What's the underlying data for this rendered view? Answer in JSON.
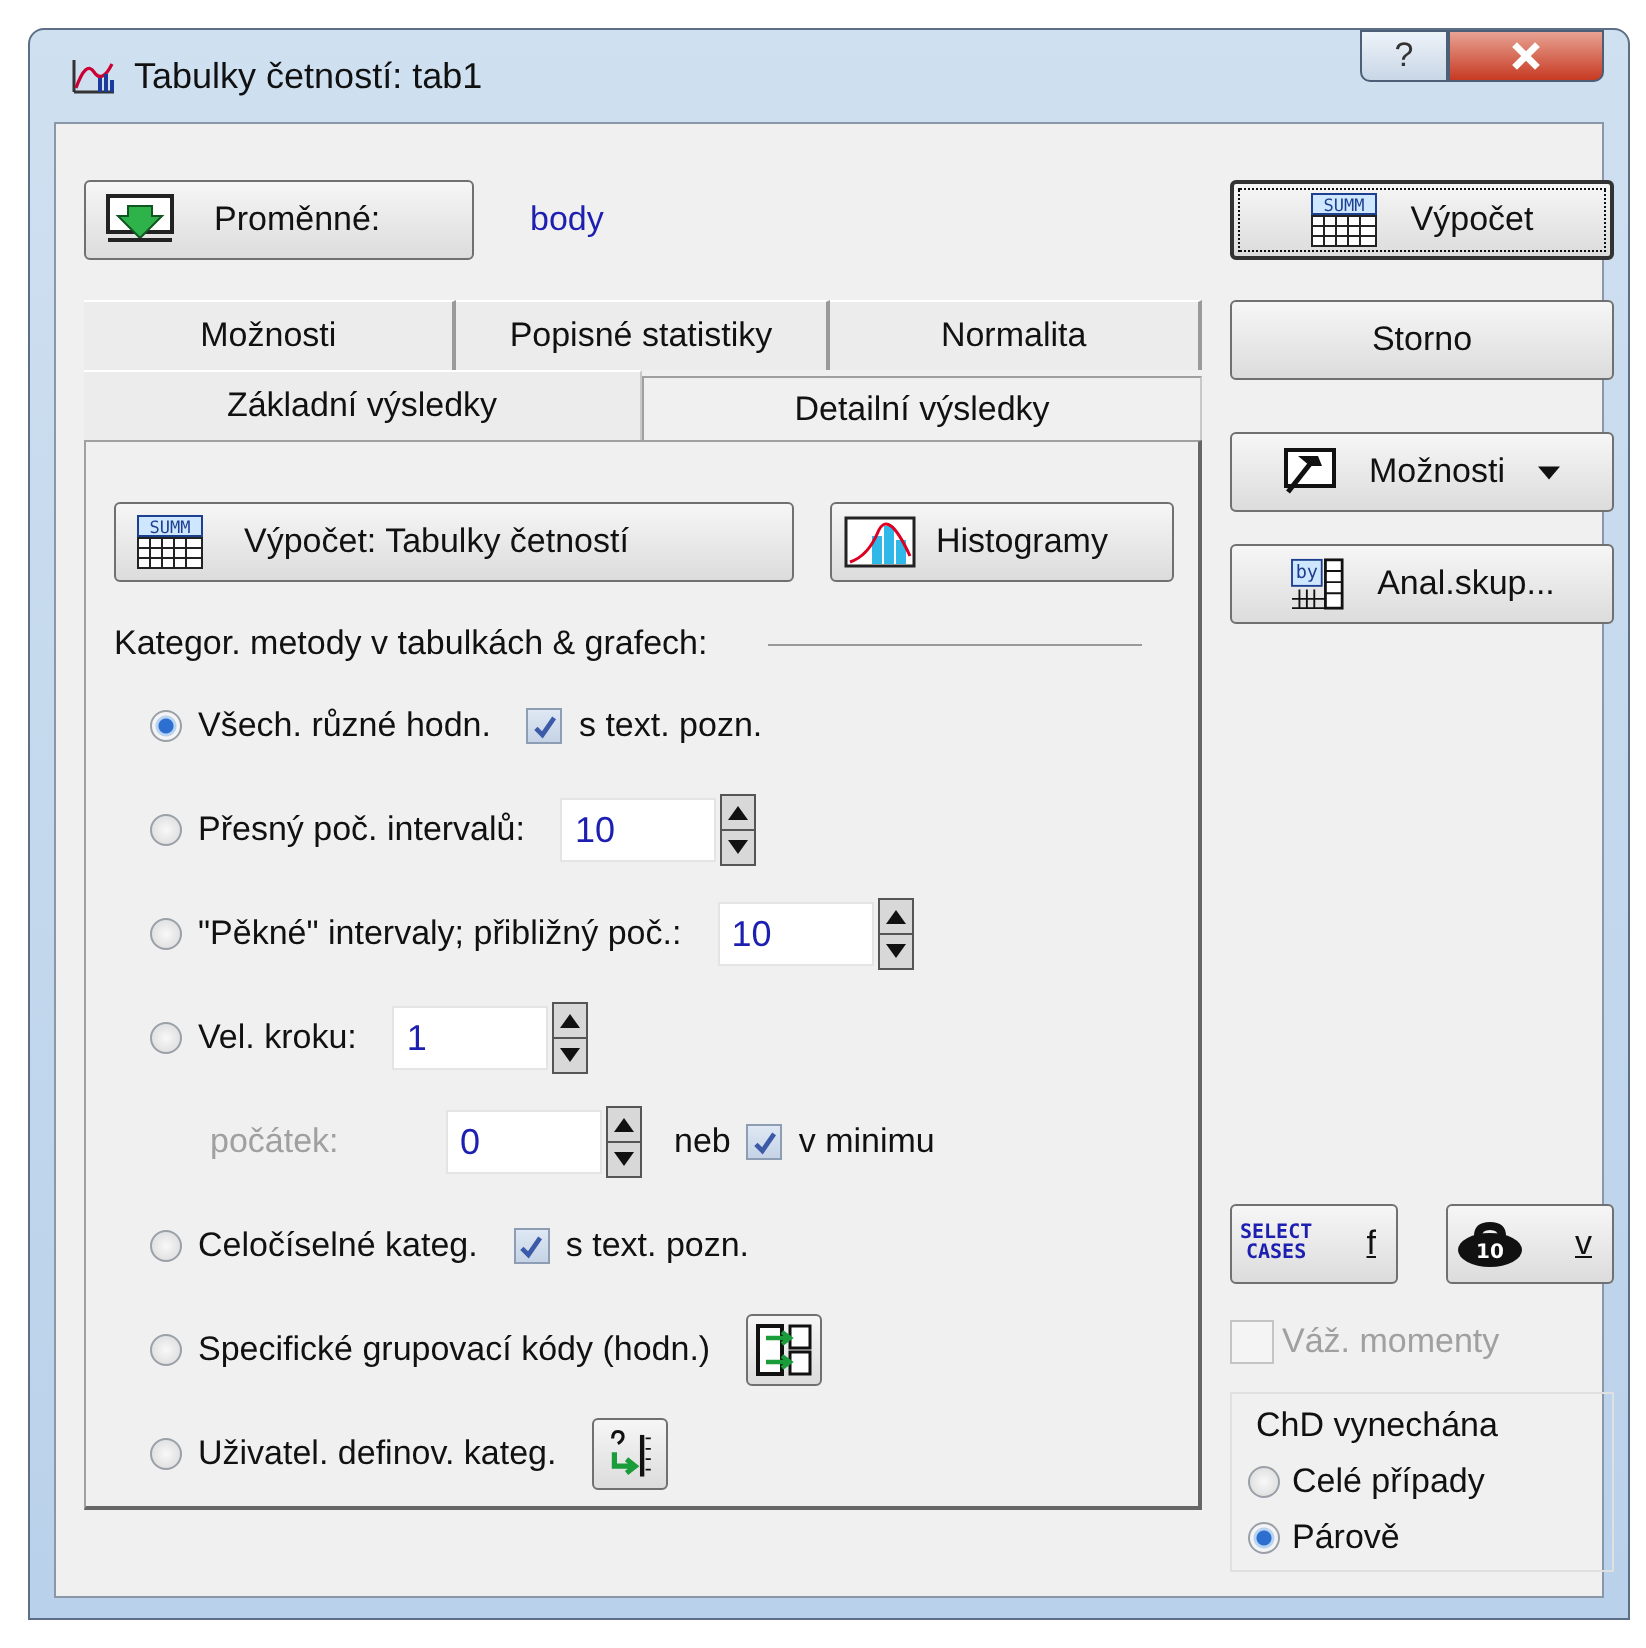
{
  "window": {
    "title": "Tabulky četností: tab1",
    "help": "?"
  },
  "variables": {
    "label": "Proměnné:",
    "value": "body"
  },
  "tab_rows": [
    [
      {
        "label": "Možnosti",
        "selected": false
      },
      {
        "label": "Popisné statistiky",
        "selected": false
      },
      {
        "label": "Normalita",
        "selected": false
      }
    ],
    [
      {
        "label": "Základní výsledky",
        "selected": false
      },
      {
        "label": "Detailní výsledky",
        "selected": true
      }
    ]
  ],
  "panel": {
    "compute_button": {
      "label": "Výpočet: Tabulky četností",
      "icon_text": "SUMM"
    },
    "histogram_button": {
      "label": "Histogramy"
    },
    "group_title": "Kategor. metody v tabulkách & grafech:",
    "options": [
      {
        "kind": "check",
        "label": "Všech. různé hodn.",
        "selected": true,
        "check": {
          "label": "s text. pozn.",
          "checked": true
        }
      },
      {
        "kind": "spin",
        "label": "Přesný poč. intervalů:",
        "selected": false,
        "value": "10"
      },
      {
        "kind": "spin",
        "label": "\"Pěkné\" intervaly; přibližný poč.:",
        "selected": false,
        "value": "10"
      },
      {
        "kind": "spin",
        "label": "Vel. kroku:",
        "selected": false,
        "value": "1",
        "sub": {
          "label": "počátek:",
          "disabled": true,
          "value": "0",
          "or_label": "neb",
          "check": {
            "label": "v minimu",
            "checked": true
          }
        }
      },
      {
        "kind": "check",
        "label": "Celočíselné kateg.",
        "selected": false,
        "check": {
          "label": "s text. pozn.",
          "checked": true
        }
      },
      {
        "kind": "button",
        "label": "Specifické grupovací kódy (hodn.)",
        "selected": false,
        "button": {
          "kind": "codes"
        }
      },
      {
        "kind": "button",
        "label": "Uživatel. definov. kateg.",
        "selected": false,
        "button": {
          "kind": "user"
        }
      }
    ]
  },
  "side_buttons": [
    {
      "kind": "summ",
      "label": "Výpočet",
      "icon_text": "SUMM",
      "default": true
    },
    {
      "kind": "plain",
      "label": "Storno",
      "default": false
    },
    {
      "kind": "menu",
      "label": "Možnosti",
      "default": false
    },
    {
      "kind": "by",
      "label": "Anal.skup...",
      "icon_text": "by",
      "default": false
    }
  ],
  "select_cases_button": {
    "icon_text": [
      "SELECT",
      "CASES"
    ],
    "label": "f"
  },
  "weight_button": {
    "icon_text": "10",
    "label": "v"
  },
  "weight_moments": {
    "label": "Váž. momenty",
    "checked": false,
    "disabled": true
  },
  "missing_data": {
    "title": "ChD vynechána",
    "options": [
      {
        "label": "Celé případy",
        "selected": false
      },
      {
        "label": "Párově",
        "selected": true
      }
    ]
  }
}
